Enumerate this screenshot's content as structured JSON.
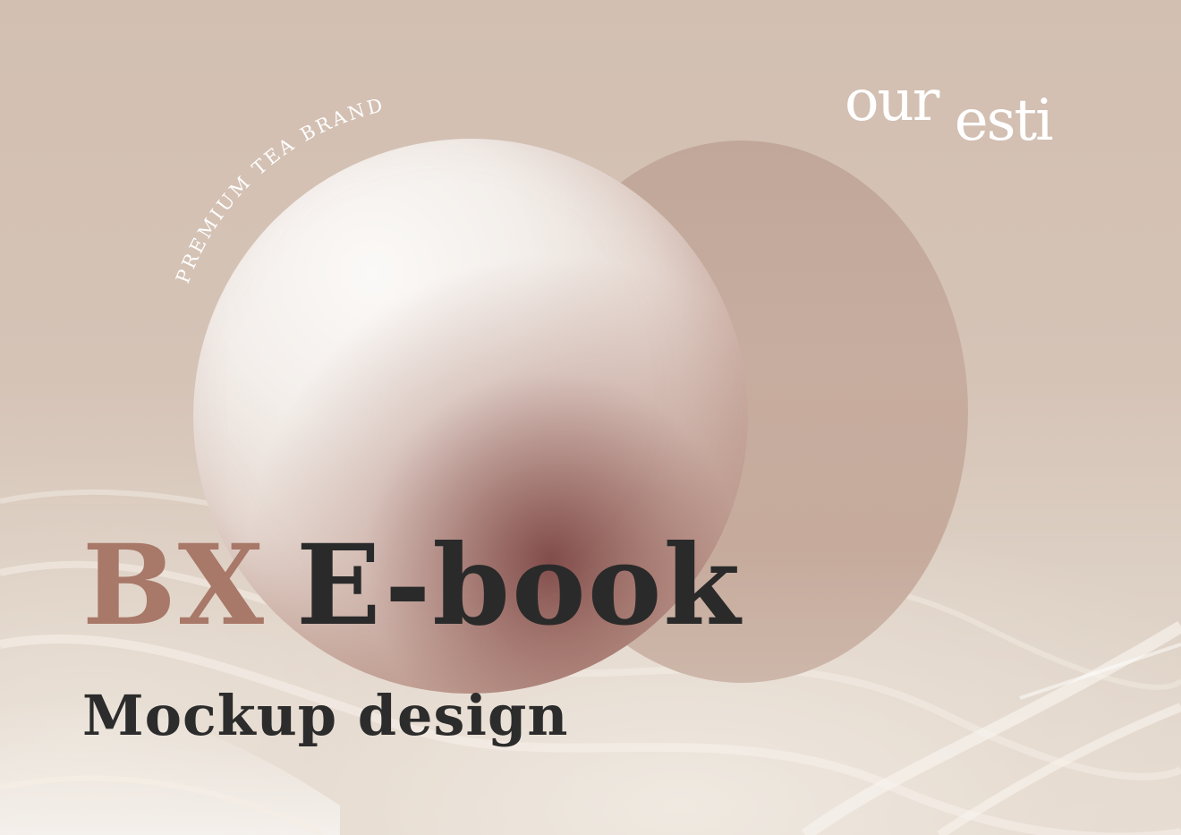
{
  "brand": {
    "logo_text": "ouresti",
    "tagline": "PREMIUM TEA BRAND"
  },
  "headline": {
    "part1": "BX",
    "part2": "E-book",
    "subtitle": "Mockup design"
  },
  "colors": {
    "background": "#d3c1b4",
    "accent": "#a87868",
    "text_dark": "#2a2a2a",
    "disc": "#c4aa9c",
    "sphere_light": "#fbf9f7",
    "sphere_shadow": "#7d4644",
    "logo": "#ffffff"
  }
}
